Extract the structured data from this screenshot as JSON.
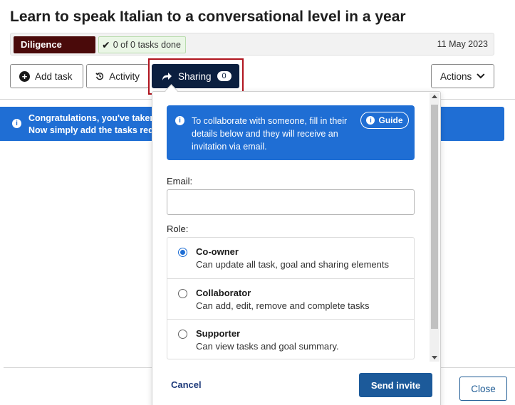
{
  "page": {
    "title": "Learn to speak Italian to a conversational level in a year"
  },
  "meta": {
    "category": "Diligence",
    "tasks_done": "0 of 0 tasks done",
    "date": "11 May 2023"
  },
  "toolbar": {
    "add_task": "Add task",
    "activity": "Activity",
    "sharing": "Sharing",
    "sharing_count": "0",
    "actions": "Actions"
  },
  "banner": {
    "text": "Congratulations, you've taken\nNow simply add the tasks req"
  },
  "sharing_popover": {
    "info_text": "To collaborate with someone, fill in their details below and they will receive an invitation via email.",
    "guide_label": "Guide",
    "email_label": "Email:",
    "email_value": "",
    "email_placeholder": "",
    "role_label": "Role:",
    "roles": [
      {
        "name": "Co-owner",
        "description": "Can update all task, goal and sharing elements",
        "selected": true
      },
      {
        "name": "Collaborator",
        "description": "Can add, edit, remove and complete tasks",
        "selected": false
      },
      {
        "name": "Supporter",
        "description": "Can view tasks and goal summary.",
        "selected": false
      }
    ],
    "cancel_label": "Cancel",
    "send_label": "Send invite"
  },
  "footer": {
    "close_label": "Close"
  },
  "colors": {
    "category_bg": "#4a0a0a",
    "sharing_bg": "#0b1f3f",
    "highlight": "#b0141e",
    "info_blue": "#1f6ed4",
    "primary_button": "#1c5a9a"
  }
}
